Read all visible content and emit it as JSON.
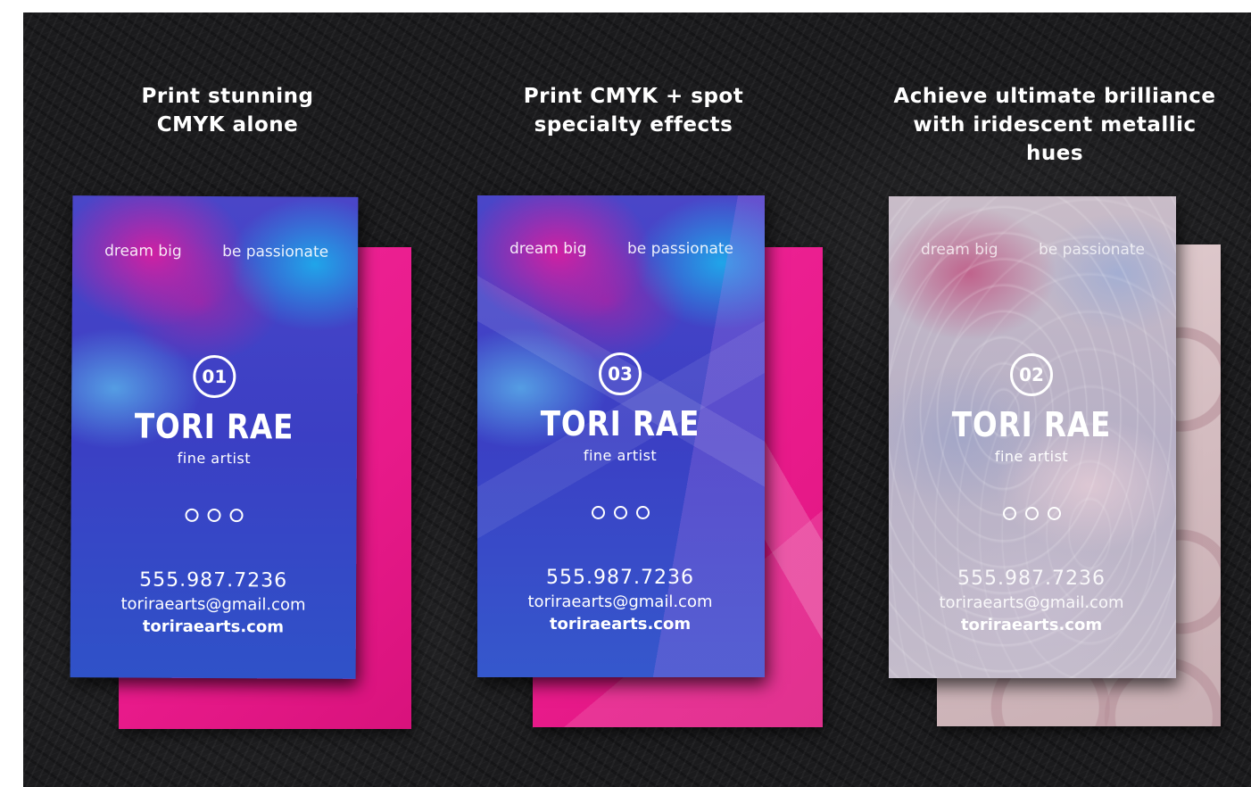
{
  "captions": [
    {
      "line1": "Print stunning",
      "line2": "CMYK alone"
    },
    {
      "line1": "Print CMYK + spot",
      "line2": "specialty effects"
    },
    {
      "line1": "Achieve ultimate brilliance",
      "line2": "with iridescent metallic hues"
    }
  ],
  "cards": [
    {
      "tag_left": "dream big",
      "tag_right": "be passionate",
      "badge": "01",
      "name": "TORI RAE",
      "title": "fine artist",
      "phone": "555.987.7236",
      "email": "toriraearts@gmail.com",
      "website": "toriraearts.com"
    },
    {
      "tag_left": "dream big",
      "tag_right": "be passionate",
      "badge": "03",
      "name": "TORI RAE",
      "title": "fine artist",
      "phone": "555.987.7236",
      "email": "toriraearts@gmail.com",
      "website": "toriraearts.com"
    },
    {
      "tag_left": "dream big",
      "tag_right": "be passionate",
      "badge": "02",
      "name": "TORI RAE",
      "title": "fine artist",
      "phone": "555.987.7236",
      "email": "toriraearts@gmail.com",
      "website": "toriraearts.com"
    }
  ],
  "colors": {
    "background": "#1b1b1d",
    "magenta_back": "#ec1f8c",
    "metallic_back": "#d9c3c6",
    "card_blue": "#3e46c8",
    "card_pink": "#c8268c",
    "card_cyan": "#1ea3e6"
  }
}
